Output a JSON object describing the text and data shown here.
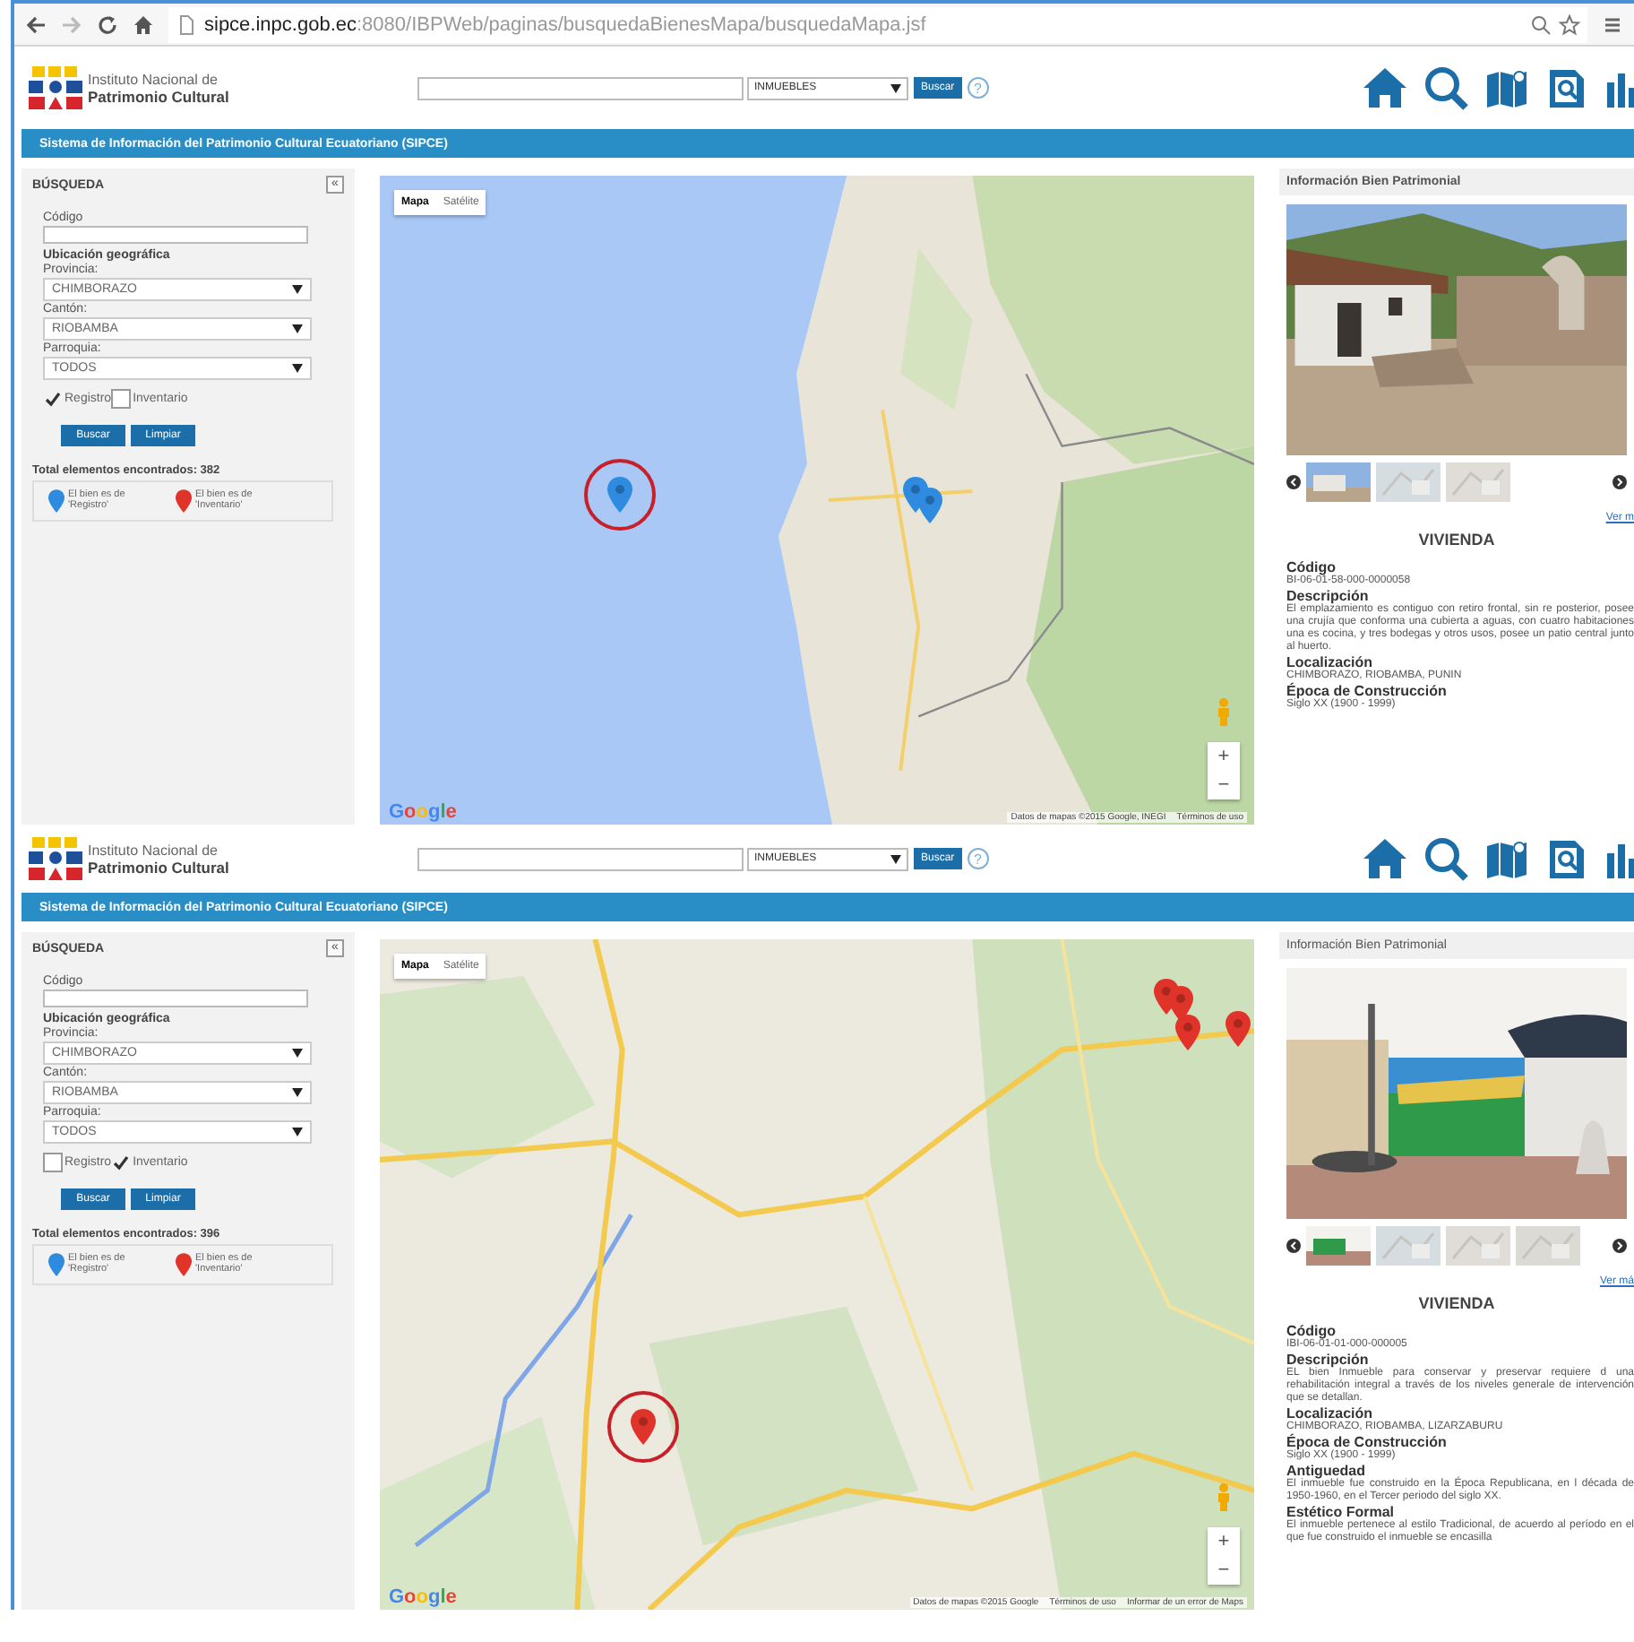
{
  "browser": {
    "url_host": "sipce.inpc.gob.ec",
    "url_path": ":8080/IBPWeb/paginas/busquedaBienesMapa/busquedaMapa.jsf"
  },
  "screens": [
    {
      "header": {
        "logo_line1": "Instituto Nacional de",
        "logo_line2": "Patrimonio Cultural",
        "category": "INMUEBLES",
        "search_button": "Buscar",
        "help": "?"
      },
      "banner": "Sistema de Información del Patrimonio Cultural Ecuatoriano (SIPCE)",
      "sidebar": {
        "title": "BÚSQUEDA",
        "collapse": "«",
        "codigo_label": "Código",
        "section": "Ubicación geográfica",
        "provincia_label": "Provincia:",
        "provincia": "CHIMBORAZO",
        "canton_label": "Cantón:",
        "canton": "RIOBAMBA",
        "parroquia_label": "Parroquia:",
        "parroquia": "TODOS",
        "checks": [
          {
            "label": "Registro",
            "checked": true
          },
          {
            "label": "Inventario",
            "checked": false
          }
        ],
        "buttons": [
          "Buscar",
          "Limpiar"
        ],
        "total": "Total elementos encontrados: 382",
        "legend": [
          {
            "color": "#2e8be0",
            "text": "El bien es de 'Registro'"
          },
          {
            "color": "#e0342a",
            "text": "El bien es de 'Inventario'"
          }
        ]
      },
      "map": {
        "types": [
          {
            "label": "Mapa",
            "selected": true
          },
          {
            "label": "Satélite",
            "selected": false
          }
        ],
        "logo": "Google",
        "markers": [
          {
            "kind": "registro",
            "circled": true
          },
          {
            "kind": "registro",
            "circled": false
          },
          {
            "kind": "registro",
            "circled": false
          }
        ],
        "zoom_in": "+",
        "zoom_out": "−",
        "attribution": "Datos de mapas ©2015 Google, INEGI",
        "links": [
          "Términos de uso"
        ]
      },
      "info": {
        "title": "Información Bien Patrimonial",
        "more_link": "Ver m",
        "name": "VIVIENDA",
        "fields": [
          {
            "label": "Código",
            "value": "BI-06-01-58-000-0000058"
          },
          {
            "label": "Descripción",
            "value": "El emplazamiento es contiguo con retiro frontal, sin re posterior, posee una crujía que conforma una cubierta a aguas, con cuatro habitaciones una es cocina, y tres bodegas y otros usos, posee un patio central junto al huerto."
          },
          {
            "label": "Localización",
            "value": "CHIMBORAZO, RIOBAMBA, PUNIN"
          },
          {
            "label": "Época de Construcción",
            "value": "Siglo XX (1900 - 1999)"
          }
        ]
      }
    },
    {
      "header": {
        "logo_line1": "Instituto Nacional de",
        "logo_line2": "Patrimonio Cultural",
        "category": "INMUEBLES",
        "search_button": "Buscar",
        "help": "?"
      },
      "banner": "Sistema de Información del Patrimonio Cultural Ecuatoriano (SIPCE)",
      "sidebar": {
        "title": "BÚSQUEDA",
        "collapse": "«",
        "codigo_label": "Código",
        "section": "Ubicación geográfica",
        "provincia_label": "Provincia:",
        "provincia": "CHIMBORAZO",
        "canton_label": "Cantón:",
        "canton": "RIOBAMBA",
        "parroquia_label": "Parroquia:",
        "parroquia": "TODOS",
        "checks": [
          {
            "label": "Registro",
            "checked": false
          },
          {
            "label": "Inventario",
            "checked": true
          }
        ],
        "buttons": [
          "Buscar",
          "Limpiar"
        ],
        "total": "Total elementos encontrados: 396",
        "legend": [
          {
            "color": "#2e8be0",
            "text": "El bien es de 'Registro'"
          },
          {
            "color": "#e0342a",
            "text": "El bien es de 'Inventario'"
          }
        ]
      },
      "map": {
        "types": [
          {
            "label": "Mapa",
            "selected": true
          },
          {
            "label": "Satélite",
            "selected": false
          }
        ],
        "logo": "Google",
        "markers": [
          {
            "kind": "inventario",
            "circled": true
          },
          {
            "kind": "inventario",
            "circled": false
          },
          {
            "kind": "inventario",
            "circled": false
          },
          {
            "kind": "inventario",
            "circled": false
          },
          {
            "kind": "inventario",
            "circled": false
          }
        ],
        "zoom_in": "+",
        "zoom_out": "−",
        "attribution": "Datos de mapas ©2015 Google",
        "links": [
          "Términos de uso",
          "Informar de un error de Maps"
        ]
      },
      "info": {
        "title": "Información Bien Patrimonial",
        "more_link": "Ver má",
        "name": "VIVIENDA",
        "fields": [
          {
            "label": "Código",
            "value": "IBI-06-01-01-000-000005"
          },
          {
            "label": "Descripción",
            "value": "EL bien Inmueble para conservar y preservar requiere d una rehabilitación integral a través de los niveles generale de intervención que se detallan."
          },
          {
            "label": "Localización",
            "value": "CHIMBORAZO, RIOBAMBA, LIZARZABURU"
          },
          {
            "label": "Época de Construcción",
            "value": "Siglo XX (1900 - 1999)"
          },
          {
            "label": "Antiguedad",
            "value": "El inmueble fue construido en la Época Republicana, en l década de 1950-1960, en el Tercer periodo del siglo XX."
          },
          {
            "label": "Estético Formal",
            "value": "El inmueble pertenece al estilo Tradicional, de acuerdo al período en el que fue construido el inmueble se encasilla"
          }
        ]
      }
    }
  ]
}
